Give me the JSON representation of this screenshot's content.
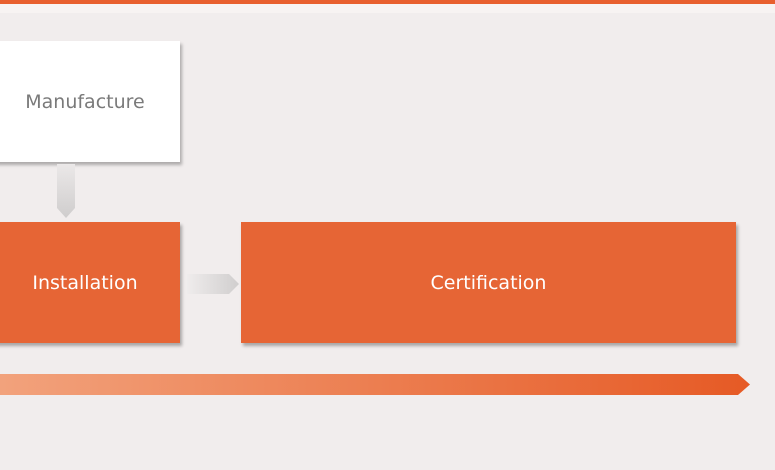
{
  "steps": {
    "manufacture": "Manufacture",
    "installation": "Installation",
    "certification": "Certification"
  },
  "colors": {
    "accent": "#e85f2e",
    "box_orange": "#e66535",
    "box_white": "#ffffff",
    "background": "#f1eded",
    "connector": "#d4d2d2"
  }
}
